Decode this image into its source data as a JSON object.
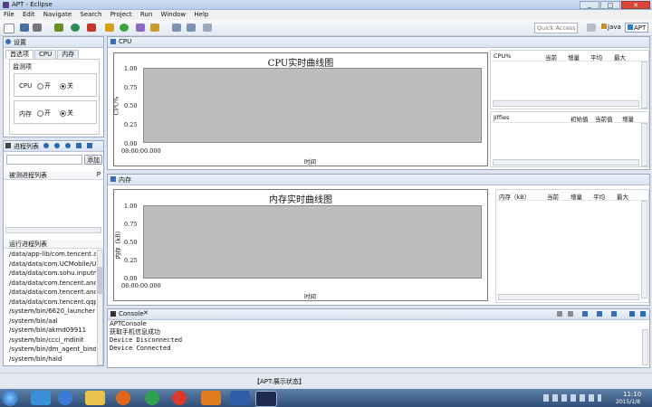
{
  "window": {
    "title": "APT - Eclipse"
  },
  "menu": [
    "File",
    "Edit",
    "Navigate",
    "Search",
    "Project",
    "Run",
    "Window",
    "Help"
  ],
  "toolbar": {
    "quick_access_placeholder": "Quick Access",
    "perspectives": [
      "Java",
      "APT"
    ]
  },
  "settings_view": {
    "title": "设置",
    "tabs": [
      "首选项",
      "CPU",
      "内存"
    ],
    "group_title": "监测项",
    "rows": [
      {
        "label": "CPU",
        "on": "开",
        "off": "关",
        "selected": "off"
      },
      {
        "label": "内存",
        "on": "开",
        "off": "关",
        "selected": "off"
      }
    ]
  },
  "process_view": {
    "title": "进程列表",
    "add_button": "添加",
    "monitored_header": "被测进程列表",
    "running_header": "运行进程列表",
    "running": [
      "/data/app-lib/com.tencent.and...",
      "/data/data/com.UCMobile/UC...",
      "/data/data/com.sohu.inputmet...",
      "/data/data/com.tencent.androi...",
      "/data/data/com.tencent.androi...",
      "/data/data/com.tencent.qqpin...",
      "/system/bin/6620_launcher",
      "/system/bin/aal",
      "/system/bin/akmd09911",
      "/system/bin/ccci_mdinit",
      "/system/bin/dm_agent_binder",
      "/system/bin/hald"
    ]
  },
  "cpu_view": {
    "tab": "CPU",
    "table1_headers": [
      "CPU%",
      "当前",
      "增量",
      "平均",
      "最大"
    ],
    "table2_headers": [
      "Jiffies",
      "初始值",
      "当前值",
      "增量"
    ]
  },
  "mem_view": {
    "tab": "内存",
    "table_headers": [
      "内存（kB）",
      "当前",
      "增量",
      "平均",
      "最大"
    ]
  },
  "chart_data": [
    {
      "type": "line",
      "title": "CPU实时曲线图",
      "xlabel": "时间",
      "ylabel": "CPU%",
      "yticks": [
        "1.00",
        "0.75",
        "0.50",
        "0.25",
        "0.00"
      ],
      "xticks": [
        "08:00:00.000"
      ],
      "ylim": [
        0,
        1
      ],
      "series": []
    },
    {
      "type": "line",
      "title": "内存实时曲线图",
      "xlabel": "时间",
      "ylabel": "内存（kB）",
      "yticks": [
        "1.00",
        "0.75",
        "0.50",
        "0.25",
        "0.00"
      ],
      "xticks": [
        "08:00:00.000"
      ],
      "ylim": [
        0,
        1
      ],
      "series": []
    }
  ],
  "console": {
    "title": "Console",
    "subtitle": "APTConsole",
    "lines": [
      "获取手机信息成功",
      "Device Disconnected",
      "Device Connected"
    ]
  },
  "status_bar": {
    "text": "【APT:展示状态】"
  },
  "taskbar": {
    "time": "11:10",
    "date": "2015/1/8"
  },
  "colors": {
    "plot_bg": "#bdbdbd",
    "chart_border": "#888888"
  }
}
